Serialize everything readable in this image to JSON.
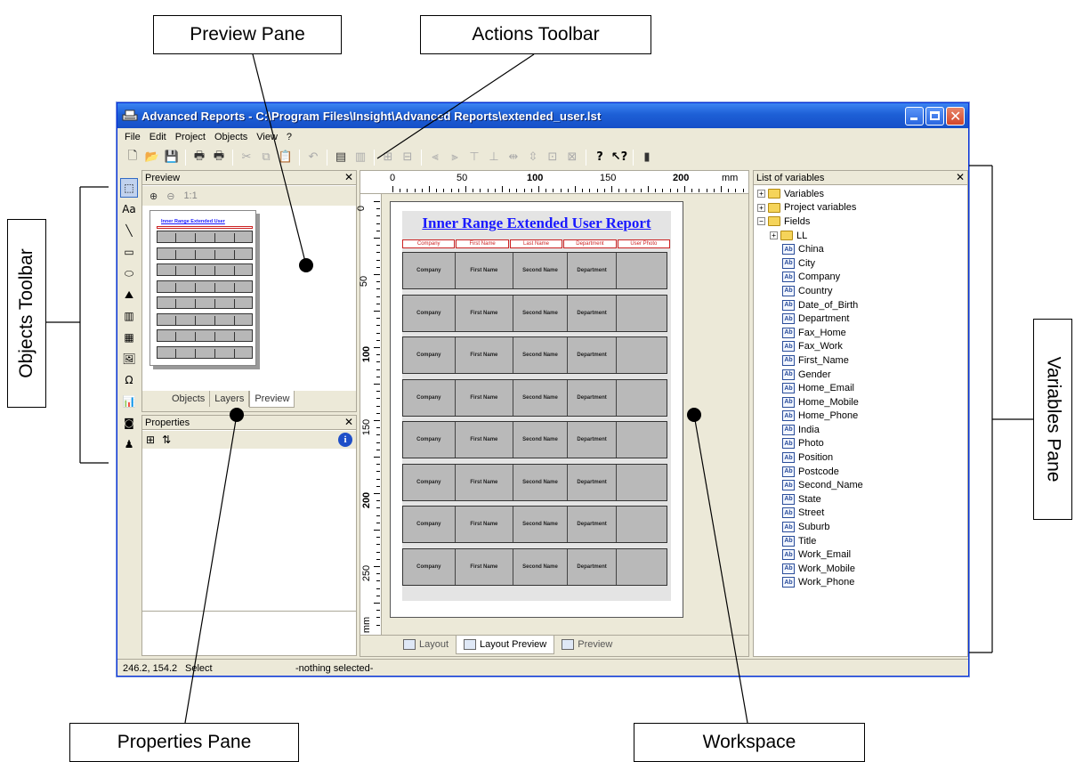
{
  "callouts": {
    "preview_pane": "Preview Pane",
    "actions_toolbar": "Actions Toolbar",
    "objects_toolbar": "Objects Toolbar",
    "variables_pane": "Variables Pane",
    "properties_pane": "Properties Pane",
    "workspace": "Workspace"
  },
  "window": {
    "title": "Advanced Reports - C:\\Program Files\\Insight\\Advanced Reports\\extended_user.lst"
  },
  "menu": [
    "File",
    "Edit",
    "Project",
    "Objects",
    "View",
    "?"
  ],
  "objects_toolbar": {
    "text_tool": "Aa"
  },
  "preview": {
    "header": "Preview",
    "zoom_label": "1:1",
    "mini_title": "Inner Range Extended User",
    "tabs": [
      "Objects",
      "Layers",
      "Preview"
    ]
  },
  "properties": {
    "header": "Properties",
    "info_glyph": "i"
  },
  "workspace": {
    "ruler_h": [
      "0",
      "50",
      "100",
      "150",
      "200",
      "mm"
    ],
    "ruler_v": [
      "0",
      "50",
      "100",
      "150",
      "200",
      "250",
      "mm"
    ],
    "report_title": "Inner Range Extended User Report",
    "columns": [
      "Company",
      "First Name",
      "Last Name",
      "Department",
      "User Photo"
    ],
    "row_cells": [
      "Company",
      "First Name",
      "Second Name",
      "Department",
      ""
    ],
    "row_count": 8,
    "tabs": [
      "Layout",
      "Layout Preview",
      "Preview"
    ]
  },
  "variables": {
    "header": "List of variables",
    "tree": [
      {
        "label": "Variables",
        "level": 0,
        "kind": "folder",
        "expander": "+"
      },
      {
        "label": "Project variables",
        "level": 0,
        "kind": "folder",
        "expander": "+"
      },
      {
        "label": "Fields",
        "level": 0,
        "kind": "folder",
        "expander": "−"
      },
      {
        "label": "LL",
        "level": 1,
        "kind": "folder",
        "expander": "+"
      },
      {
        "label": "China",
        "level": 2,
        "kind": "field"
      },
      {
        "label": "City",
        "level": 2,
        "kind": "field"
      },
      {
        "label": "Company",
        "level": 2,
        "kind": "field"
      },
      {
        "label": "Country",
        "level": 2,
        "kind": "field"
      },
      {
        "label": "Date_of_Birth",
        "level": 2,
        "kind": "field"
      },
      {
        "label": "Department",
        "level": 2,
        "kind": "field"
      },
      {
        "label": "Fax_Home",
        "level": 2,
        "kind": "field"
      },
      {
        "label": "Fax_Work",
        "level": 2,
        "kind": "field"
      },
      {
        "label": "First_Name",
        "level": 2,
        "kind": "field"
      },
      {
        "label": "Gender",
        "level": 2,
        "kind": "field"
      },
      {
        "label": "Home_Email",
        "level": 2,
        "kind": "field"
      },
      {
        "label": "Home_Mobile",
        "level": 2,
        "kind": "field"
      },
      {
        "label": "Home_Phone",
        "level": 2,
        "kind": "field"
      },
      {
        "label": "India",
        "level": 2,
        "kind": "field"
      },
      {
        "label": "Photo",
        "level": 2,
        "kind": "field"
      },
      {
        "label": "Position",
        "level": 2,
        "kind": "field"
      },
      {
        "label": "Postcode",
        "level": 2,
        "kind": "field"
      },
      {
        "label": "Second_Name",
        "level": 2,
        "kind": "field"
      },
      {
        "label": "State",
        "level": 2,
        "kind": "field"
      },
      {
        "label": "Street",
        "level": 2,
        "kind": "field"
      },
      {
        "label": "Suburb",
        "level": 2,
        "kind": "field"
      },
      {
        "label": "Title",
        "level": 2,
        "kind": "field"
      },
      {
        "label": "Work_Email",
        "level": 2,
        "kind": "field"
      },
      {
        "label": "Work_Mobile",
        "level": 2,
        "kind": "field"
      },
      {
        "label": "Work_Phone",
        "level": 2,
        "kind": "field"
      }
    ],
    "field_icon_text": "Ab"
  },
  "status": {
    "coords": "246.2, 154.2",
    "mode": "Select",
    "selection": "-nothing selected-"
  },
  "colors": {
    "titlebar": "#1d5fd6",
    "report_title": "#1a1aff",
    "column_header": "#cc2222",
    "row_fill": "#b9b9b9"
  }
}
